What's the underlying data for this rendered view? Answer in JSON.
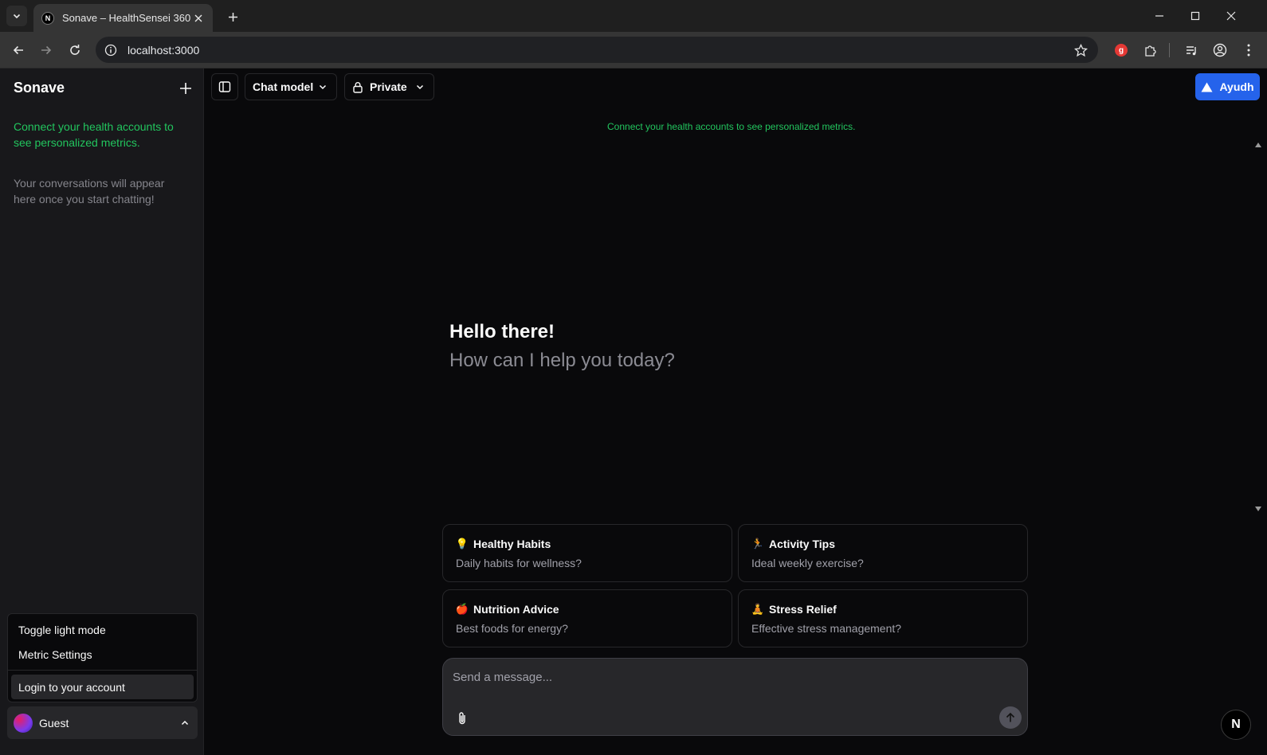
{
  "browser": {
    "tab": {
      "title": "Sonave – HealthSensei 360",
      "favicon": "N"
    },
    "url": "localhost:3000",
    "extension_badge": "g"
  },
  "sidebar": {
    "brand": "Sonave",
    "connect_text": "Connect your health accounts to see personalized metrics.",
    "empty_text": "Your conversations will appear here once you start chatting!",
    "menu": {
      "toggle_theme": "Toggle light mode",
      "metric_settings": "Metric Settings",
      "login": "Login to your account"
    },
    "user": {
      "name": "Guest"
    }
  },
  "header": {
    "model_label": "Chat model",
    "visibility_label": "Private",
    "deploy_label": "Ayudh"
  },
  "main": {
    "connect_text": "Connect your health accounts to see personalized metrics.",
    "greeting_title": "Hello there!",
    "greeting_sub": "How can I help you today?",
    "suggestions": [
      {
        "emoji": "💡",
        "title": "Healthy Habits",
        "subtitle": "Daily habits for wellness?"
      },
      {
        "emoji": "🏃",
        "title": "Activity Tips",
        "subtitle": "Ideal weekly exercise?"
      },
      {
        "emoji": "🍎",
        "title": "Nutrition Advice",
        "subtitle": "Best foods for energy?"
      },
      {
        "emoji": "🧘",
        "title": "Stress Relief",
        "subtitle": "Effective stress management?"
      }
    ],
    "composer": {
      "placeholder": "Send a message..."
    },
    "badge": "N"
  },
  "colors": {
    "accent_green": "#22c55e",
    "primary_blue": "#2563eb",
    "background": "#09090b",
    "sidebar_bg": "#18181b"
  }
}
